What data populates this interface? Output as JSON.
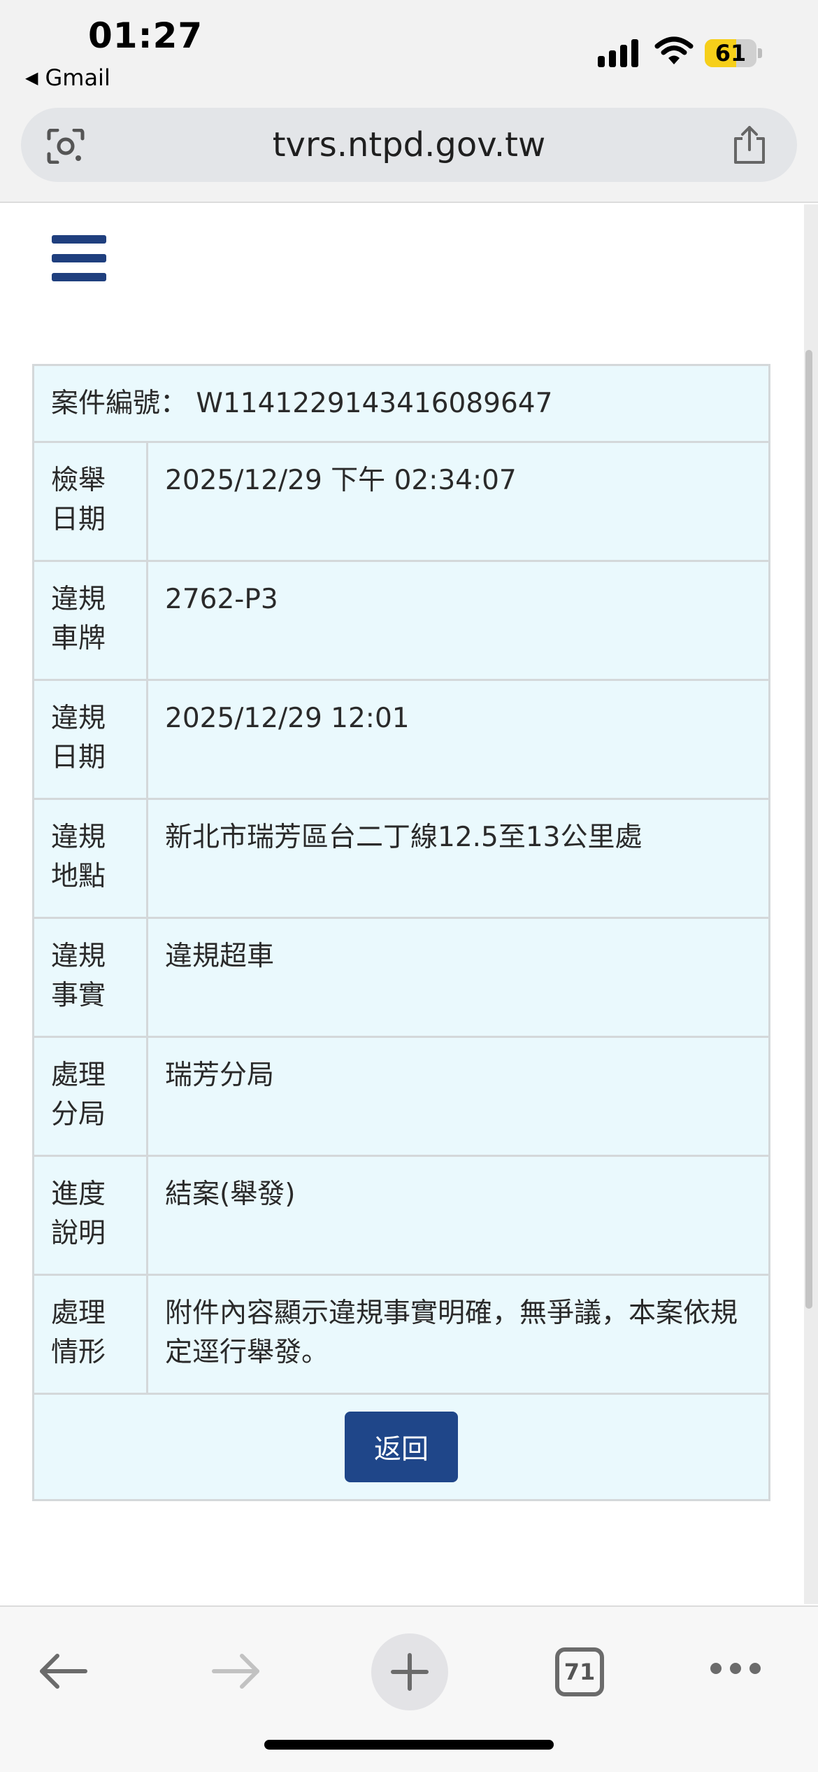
{
  "status_bar": {
    "time": "01:27",
    "back_app": "Gmail",
    "battery_level": "61",
    "battery_fraction": 0.61
  },
  "browser": {
    "url": "tvrs.ntpd.gov.tw",
    "tab_count": "71"
  },
  "case": {
    "label": "案件編號：",
    "number": "W1141229143416089647"
  },
  "rows": [
    {
      "label": "檢舉\n日期",
      "value": "2025/12/29 下午 02:34:07"
    },
    {
      "label": "違規\n車牌",
      "value": "2762-P3"
    },
    {
      "label": "違規\n日期",
      "value": "2025/12/29 12:01"
    },
    {
      "label": "違規\n地點",
      "value": "新北市瑞芳區台二丁線12.5至13公里處"
    },
    {
      "label": "違規\n事實",
      "value": "違規超車"
    },
    {
      "label": "處理\n分局",
      "value": "瑞芳分局"
    },
    {
      "label": "進度\n說明",
      "value": "結案(舉發)"
    },
    {
      "label": "處理\n情形",
      "value": "附件內容顯示違規事實明確，無爭議，本案依規定逕行舉發。"
    }
  ],
  "return_button": "返回",
  "icons": {
    "lens": "camera-search-icon",
    "share": "share-icon",
    "menu": "hamburger-menu-icon",
    "back": "arrow-left-icon",
    "forward": "arrow-right-icon",
    "new_tab": "plus-icon",
    "more": "more-dots-icon"
  },
  "colors": {
    "brand_blue": "#1f4689",
    "table_bg": "#eaf9fd",
    "battery_fill": "#f6cf1a"
  }
}
